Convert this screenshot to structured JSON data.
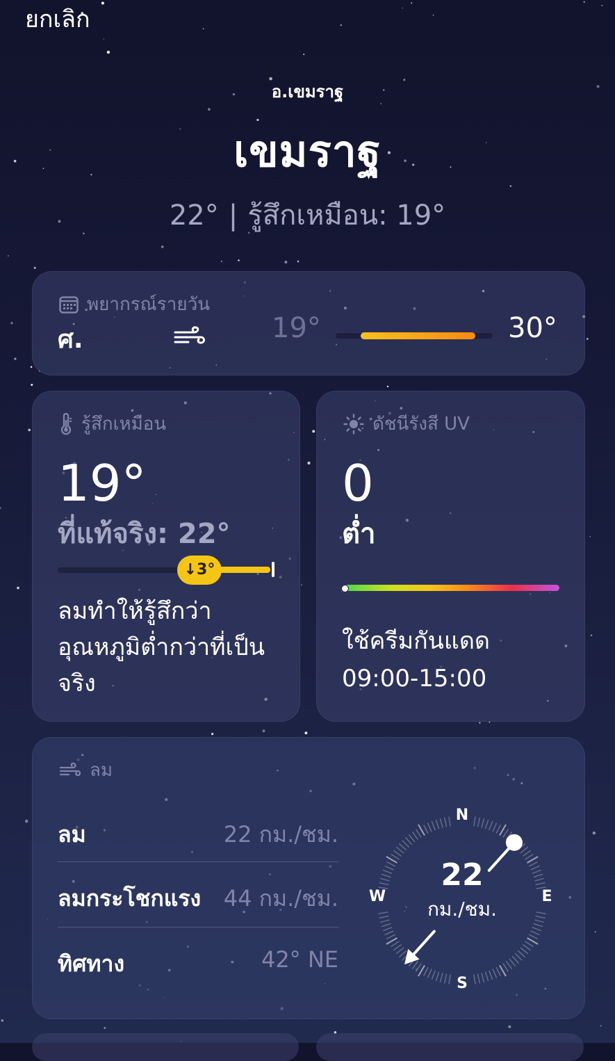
{
  "nav": {
    "cancel_label": "ยกเลิก"
  },
  "header": {
    "district": "อ.เขมราฐ",
    "city": "เขมราฐ",
    "temperature": "22°",
    "separator": "|",
    "feels_like": "รู้สึกเหมือน: 19°"
  },
  "daily_forecast": {
    "title": "พยากรณ์รายวัน",
    "title_icon": "calendar-icon",
    "row": {
      "day": "ศ.",
      "condition_icon": "wind-icon",
      "low": "19°",
      "high": "30°"
    }
  },
  "feels_like_card": {
    "title": "รู้สึกเหมือน",
    "title_icon": "thermometer-icon",
    "value": "19°",
    "actual": "ที่แท้จริง: 22°",
    "difference": "↓3°",
    "description": "ลมทำให้รู้สึกว่าอุณหภูมิต่ำกว่าที่เป็นจริง",
    "accent": "#f4c515"
  },
  "uv_card": {
    "title": "ดัชนีรังสี UV",
    "title_icon": "sun-icon",
    "value": "0",
    "level": "ต่ำ",
    "recommendation": "ใช้ครีมกันแดด",
    "time_range": "09:00-15:00"
  },
  "wind_card": {
    "title": "ลม",
    "title_icon": "wind-icon",
    "rows": [
      {
        "label": "ลม",
        "value": "22 กม./ชม."
      },
      {
        "label": "ลมกระโชกแรง",
        "value": "44 กม./ชม."
      },
      {
        "label": "ทิศทาง",
        "value": "42° NE"
      }
    ],
    "compass": {
      "speed": "22",
      "unit": "กม./ชม.",
      "north": "N",
      "east": "E",
      "south": "S",
      "west": "W",
      "direction_degrees": 42
    }
  }
}
